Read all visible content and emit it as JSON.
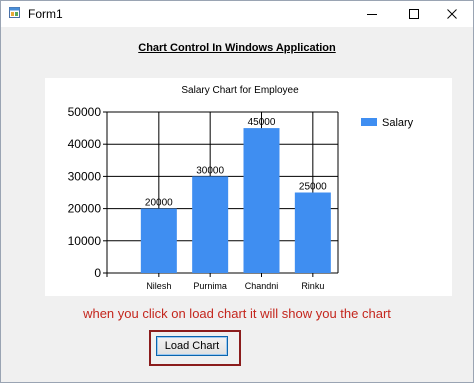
{
  "window": {
    "title": "Form1",
    "app_icon": "winforms-app-icon",
    "controls": [
      "minimize-icon",
      "maximize-icon",
      "close-icon"
    ]
  },
  "heading": "Chart Control In Windows Application",
  "info_text": "when you click on load chart it will show you the chart",
  "load_button": {
    "label": "Load Chart"
  },
  "colors": {
    "bar": "#3f8ef1",
    "info_text": "#c4261d",
    "button_highlight": "#8b1c1c",
    "window_bg": "#f0f0f0"
  },
  "chart_data": {
    "type": "bar",
    "title": "Salary Chart for Employee",
    "categories": [
      "Nilesh",
      "Purnima",
      "Chandni",
      "Rinku"
    ],
    "series": [
      {
        "name": "Salary",
        "values": [
          20000,
          30000,
          45000,
          25000
        ]
      }
    ],
    "data_labels": [
      "20000",
      "30000",
      "45000",
      "25000"
    ],
    "ylim": [
      0,
      50000
    ],
    "yticks": [
      0,
      10000,
      20000,
      30000,
      40000,
      50000
    ],
    "ytick_labels": [
      "0",
      "10000",
      "20000",
      "30000",
      "40000",
      "50000"
    ],
    "grid": true,
    "legend": "top-right",
    "xlabel": "",
    "ylabel": ""
  }
}
